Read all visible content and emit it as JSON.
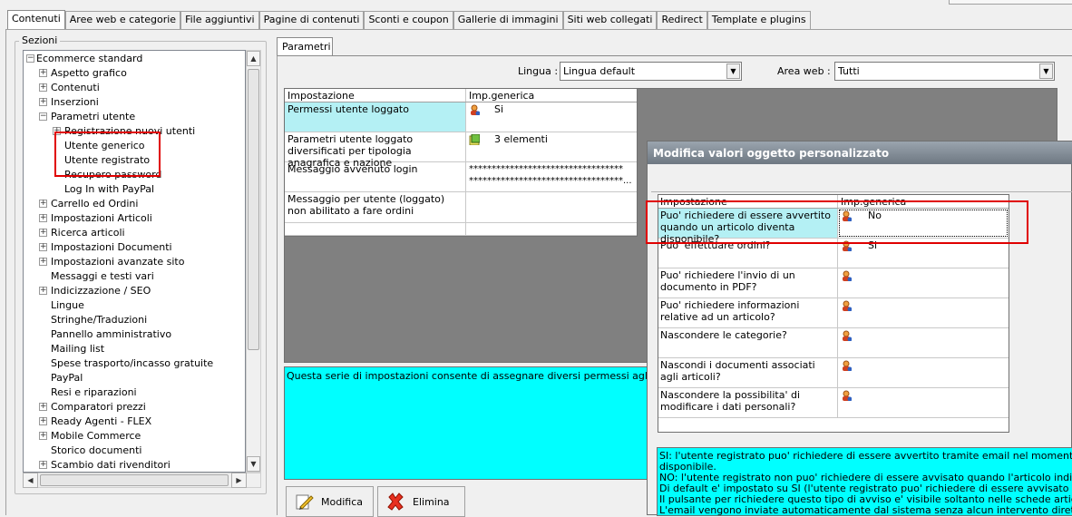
{
  "tabs": [
    "Contenuti",
    "Aree web e categorie",
    "File aggiuntivi",
    "Pagine di contenuti",
    "Sconti e coupon",
    "Gallerie di immagini",
    "Siti web collegati",
    "Redirect",
    "Template e plugins"
  ],
  "sections": {
    "label": "Sezioni",
    "items": [
      {
        "label": "Ecommerce standard",
        "level": 0,
        "exp": "−"
      },
      {
        "label": "Aspetto grafico",
        "level": 1,
        "exp": "+"
      },
      {
        "label": "Contenuti",
        "level": 1,
        "exp": "+"
      },
      {
        "label": "Inserzioni",
        "level": 1,
        "exp": "+"
      },
      {
        "label": "Parametri utente",
        "level": 1,
        "exp": "−"
      },
      {
        "label": "Registrazione nuovi utenti",
        "level": 2,
        "exp": "+"
      },
      {
        "label": "Utente generico",
        "level": 2,
        "exp": ""
      },
      {
        "label": "Utente registrato",
        "level": 2,
        "exp": ""
      },
      {
        "label": "Recupero password",
        "level": 2,
        "exp": ""
      },
      {
        "label": "Log In with PayPal",
        "level": 2,
        "exp": ""
      },
      {
        "label": "Carrello ed Ordini",
        "level": 1,
        "exp": "+"
      },
      {
        "label": "Impostazioni Articoli",
        "level": 1,
        "exp": "+"
      },
      {
        "label": "Ricerca articoli",
        "level": 1,
        "exp": "+"
      },
      {
        "label": "Impostazioni Documenti",
        "level": 1,
        "exp": "+"
      },
      {
        "label": "Impostazioni avanzate sito",
        "level": 1,
        "exp": "+"
      },
      {
        "label": "Messaggi e testi vari",
        "level": 1,
        "exp": ""
      },
      {
        "label": "Indicizzazione / SEO",
        "level": 1,
        "exp": "+"
      },
      {
        "label": "Lingue",
        "level": 1,
        "exp": ""
      },
      {
        "label": "Stringhe/Traduzioni",
        "level": 1,
        "exp": ""
      },
      {
        "label": "Pannello amministrativo",
        "level": 1,
        "exp": ""
      },
      {
        "label": "Mailing list",
        "level": 1,
        "exp": ""
      },
      {
        "label": "Spese trasporto/incasso gratuite",
        "level": 1,
        "exp": ""
      },
      {
        "label": "PayPal",
        "level": 1,
        "exp": ""
      },
      {
        "label": "Resi e riparazioni",
        "level": 1,
        "exp": ""
      },
      {
        "label": "Comparatori prezzi",
        "level": 1,
        "exp": "+"
      },
      {
        "label": "Ready Agenti - FLEX",
        "level": 1,
        "exp": "+"
      },
      {
        "label": "Mobile Commerce",
        "level": 1,
        "exp": "+"
      },
      {
        "label": "Storico documenti",
        "level": 1,
        "exp": ""
      },
      {
        "label": "Scambio dati rivenditori",
        "level": 1,
        "exp": "+"
      }
    ]
  },
  "params": {
    "tab": "Parametri",
    "lingua_label": "Lingua :",
    "lingua_value": "Lingua default",
    "area_label": "Area web :",
    "area_value": "Tutti",
    "col1": "Impostazione",
    "col2": "Imp.generica",
    "rows": [
      {
        "c1": "Permessi utente loggato",
        "c2": "Si",
        "icon": "user"
      },
      {
        "c1": "Parametri utente loggato diversificati per tipologia anagrafica e nazione",
        "c2": "3 elementi",
        "icon": "list"
      },
      {
        "c1": "Messaggio avvenuto login",
        "c2": "**********************************\n**********************************...",
        "icon": ""
      },
      {
        "c1": "Messaggio per utente (loggato) non abilitato a fare ordini",
        "c2": "",
        "icon": ""
      }
    ],
    "description": "Questa serie di impostazioni consente di assegnare diversi permessi agli utenti (dopo"
  },
  "buttons": {
    "modifica": "Modifica",
    "elimina": "Elimina"
  },
  "dialog": {
    "title": "Modifica valori oggetto personalizzato",
    "col1": "Impostazione",
    "col2": "Imp.generica",
    "rows": [
      {
        "c1": "Puo' richiedere di essere avvertito quando un articolo diventa disponibile?",
        "c2": "No"
      },
      {
        "c1": "Puo' effettuare ordini?",
        "c2": "Si"
      },
      {
        "c1": "Puo' richiedere l'invio di un documento in PDF?",
        "c2": ""
      },
      {
        "c1": "Puo' richiedere informazioni relative ad un articolo?",
        "c2": ""
      },
      {
        "c1": "Nascondere le categorie?",
        "c2": ""
      },
      {
        "c1": "Nascondi i documenti associati agli articoli?",
        "c2": ""
      },
      {
        "c1": "Nascondere la possibilita' di modificare i dati personali?",
        "c2": ""
      }
    ],
    "description": [
      "SI: l'utente registrato puo' richiedere di essere avvertito tramite email nel momento in cui l'artico",
      "disponibile.",
      "NO: l'utente registrato non puo' richiedere di essere avvisato quando l'articolo indicato diventa d",
      "Di default e' impostato su SI (l'utente registrato puo' richiedere di essere avvisato sulla disponibi",
      "Il pulsante per richiedere questo tipo di avviso e' visibile soltanto nelle schede articolo con dispo",
      "L'email vengono inviate automaticamente dal sistema senza alcun intervento diretto da parte de"
    ]
  }
}
